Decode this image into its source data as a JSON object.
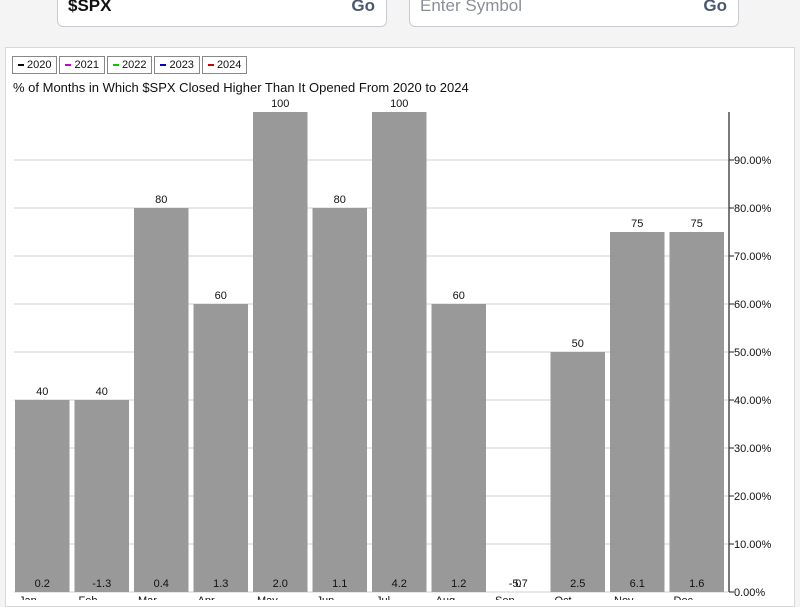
{
  "search": {
    "left_value": "$SPX",
    "left_go": "Go",
    "right_placeholder": "Enter Symbol",
    "right_go": "Go"
  },
  "legend": [
    {
      "label": "2020",
      "color": "#000000"
    },
    {
      "label": "2021",
      "color": "#cc00cc"
    },
    {
      "label": "2022",
      "color": "#00cc00"
    },
    {
      "label": "2023",
      "color": "#0000cc"
    },
    {
      "label": "2024",
      "color": "#cc0000"
    }
  ],
  "chart_data": {
    "type": "bar",
    "title": "% of Months in Which $SPX Closed Higher Than It Opened From 2020 to 2024",
    "categories": [
      "Jan",
      "Feb",
      "Mar",
      "Apr",
      "May",
      "Jun",
      "Jul",
      "Aug",
      "Sep",
      "Oct",
      "Nov",
      "Dec"
    ],
    "values": [
      40,
      40,
      80,
      60,
      100,
      80,
      100,
      60,
      0,
      50,
      75,
      75
    ],
    "bar_labels": [
      "40",
      "40",
      "80",
      "60",
      "100",
      "80",
      "100",
      "60",
      "0",
      "50",
      "75",
      "75"
    ],
    "avg_change_labels": [
      "0.2",
      "-1.3",
      "0.4",
      "1.3",
      "2.0",
      "1.1",
      "4.2",
      "1.2",
      "-5.7",
      "2.5",
      "6.1",
      "1.6"
    ],
    "y_ticks": [
      0,
      10,
      20,
      30,
      40,
      50,
      60,
      70,
      80,
      90
    ],
    "y_tick_labels": [
      "0.00%",
      "10.00%",
      "20.00%",
      "30.00%",
      "40.00%",
      "50.00%",
      "60.00%",
      "70.00%",
      "80.00%",
      "90.00%"
    ],
    "ylim": [
      0,
      100
    ],
    "y_axis_side": "right",
    "grid": true,
    "bar_color": "#999999"
  }
}
